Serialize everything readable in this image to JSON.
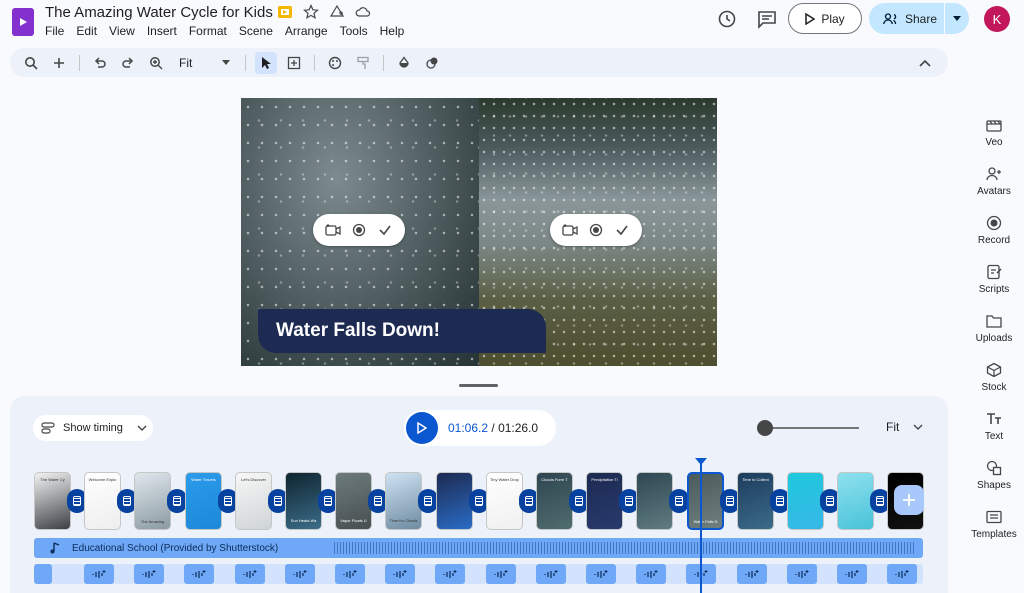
{
  "app": {
    "title": "The Amazing Water Cycle for Kids"
  },
  "menu": [
    "File",
    "Edit",
    "View",
    "Insert",
    "Format",
    "Scene",
    "Arrange",
    "Tools",
    "Help"
  ],
  "header": {
    "play_label": "Play",
    "share_label": "Share",
    "avatar_initial": "K"
  },
  "toolbar": {
    "zoom_value": "Fit"
  },
  "canvas": {
    "caption": "Water Falls Down!"
  },
  "sidebar": [
    {
      "id": "veo",
      "label": "Veo",
      "icon": "veo-icon"
    },
    {
      "id": "avatars",
      "label": "Avatars",
      "icon": "avatar-add-icon"
    },
    {
      "id": "record",
      "label": "Record",
      "icon": "record-icon"
    },
    {
      "id": "scripts",
      "label": "Scripts",
      "icon": "script-edit-icon"
    },
    {
      "id": "uploads",
      "label": "Uploads",
      "icon": "folder-icon"
    },
    {
      "id": "stock",
      "label": "Stock",
      "icon": "stock-icon"
    },
    {
      "id": "text",
      "label": "Text",
      "icon": "text-icon"
    },
    {
      "id": "shapes",
      "label": "Shapes",
      "icon": "shapes-icon"
    },
    {
      "id": "templates",
      "label": "Templates",
      "icon": "templates-icon"
    }
  ],
  "timeline": {
    "show_timing_label": "Show timing",
    "current_time": "01:06.2",
    "separator": " / ",
    "total_time": "01:26.0",
    "zoom_label": "Fit",
    "audio_track_label": "Educational School (Provided by Shutterstock)",
    "scenes": [
      {
        "label": "The Water Cy",
        "colors": [
          "#f3f3f3",
          "#3b3f44"
        ]
      },
      {
        "label": "Welcome Explo",
        "colors": [
          "#ffffff",
          "#eeeeee"
        ]
      },
      {
        "label": "The Amazing",
        "colors": [
          "#dfe7ec",
          "#8b9aa3"
        ]
      },
      {
        "label": "Water Travels",
        "colors": [
          "#2b9bea",
          "#1d88d8"
        ]
      },
      {
        "label": "Let's Discover",
        "colors": [
          "#f7f7f7",
          "#cfd4d6"
        ]
      },
      {
        "label": "Sun Heats Wa",
        "colors": [
          "#0f2430",
          "#3b6d89"
        ]
      },
      {
        "label": "Vapor Floats U",
        "colors": [
          "#6d7b7d",
          "#474f50"
        ]
      },
      {
        "label": "Time for Clouds",
        "colors": [
          "#cfe2f3",
          "#6e8ba1"
        ]
      },
      {
        "label": "",
        "colors": [
          "#1d2a52",
          "#2a6cc6"
        ]
      },
      {
        "label": "Tiny Water Drop",
        "colors": [
          "#ffffff",
          "#f0f0f0"
        ]
      },
      {
        "label": "Clouds Form T",
        "colors": [
          "#2e4651",
          "#4f6c6e"
        ]
      },
      {
        "label": "Precipitation Ti",
        "colors": [
          "#1d2a52",
          "#283a6c"
        ]
      },
      {
        "label": "",
        "colors": [
          "#2e4853",
          "#5f7b80"
        ]
      },
      {
        "label": "Water Falls D",
        "colors": [
          "#4b5b5c",
          "#6f7f7e"
        ]
      },
      {
        "label": "Time to Collect",
        "colors": [
          "#1d3c5c",
          "#3c6b8a"
        ]
      },
      {
        "label": "",
        "colors": [
          "#1ec9dc",
          "#38b7e8"
        ]
      },
      {
        "label": "",
        "colors": [
          "#8fe1ee",
          "#48c3d9"
        ]
      },
      {
        "label": "",
        "colors": [
          "#000000",
          "#111111"
        ]
      }
    ]
  }
}
